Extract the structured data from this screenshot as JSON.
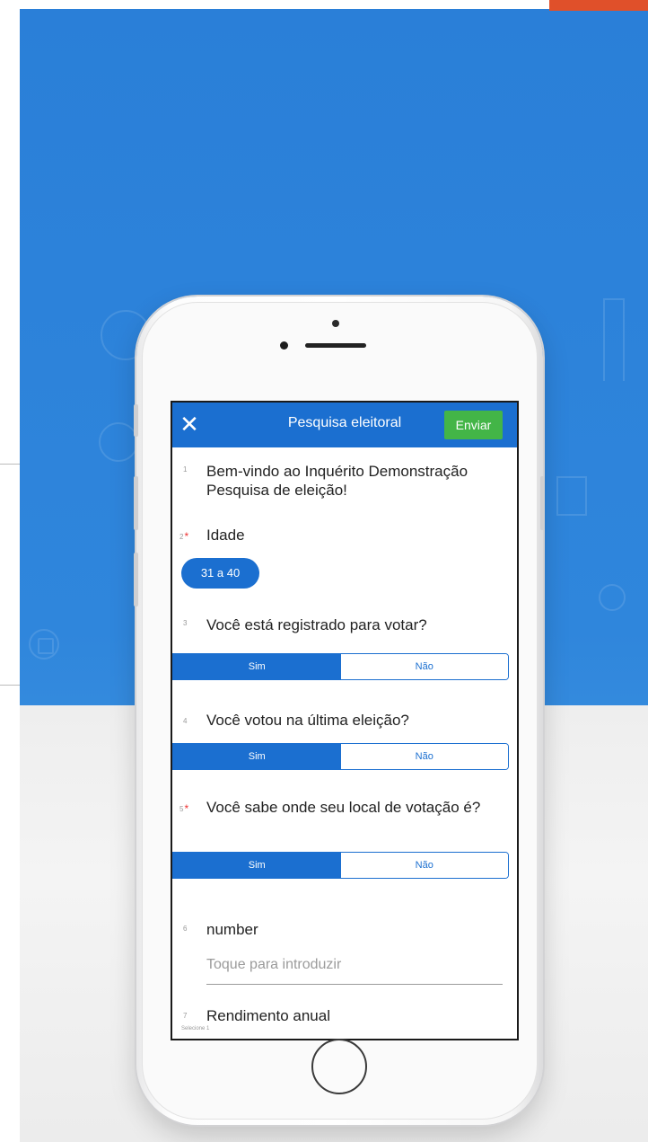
{
  "app": {
    "title": "Pesquisa eleitoral",
    "send_label": "Enviar"
  },
  "colors": {
    "background_blue": "#2a7fd8",
    "appbar_blue": "#1b6fd0",
    "send_green": "#43b547",
    "required_red": "#e33333",
    "accent_orange": "#e0502a"
  },
  "icons": {
    "close": "close-icon"
  },
  "questions": [
    {
      "number": "1",
      "required": false,
      "text": "Bem-vindo ao Inquérito Demonstração Pesquisa de eleição!"
    },
    {
      "number": "2",
      "required": true,
      "text": "Idade",
      "selected": "31 a 40"
    },
    {
      "number": "3",
      "required": false,
      "text": "Você está registrado para votar?",
      "options": [
        "Sim",
        "Não"
      ],
      "selected": "Sim"
    },
    {
      "number": "4",
      "required": false,
      "text": "Você votou na última eleição?",
      "options": [
        "Sim",
        "Não"
      ],
      "selected": "Sim"
    },
    {
      "number": "5",
      "required": true,
      "text": "Você sabe onde seu local de votação é?",
      "options": [
        "Sim",
        "Não"
      ],
      "selected": "Sim"
    },
    {
      "number": "6",
      "required": false,
      "text": "number",
      "placeholder": "Toque para introduzir"
    },
    {
      "number": "7",
      "required": false,
      "text": "Rendimento anual",
      "hint": "Selecione 1"
    }
  ]
}
